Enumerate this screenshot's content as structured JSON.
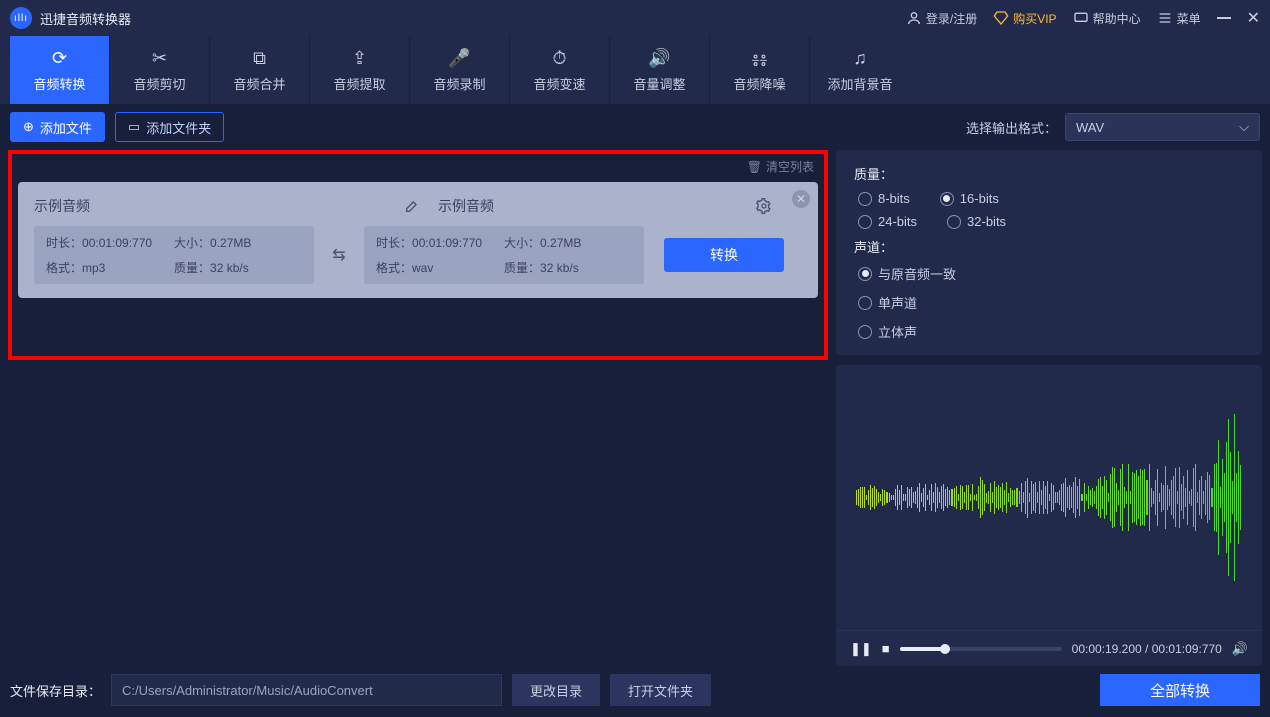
{
  "app": {
    "title": "迅捷音频转换器"
  },
  "header": {
    "login": "登录/注册",
    "vip": "购买VIP",
    "help": "帮助中心",
    "menu": "菜单"
  },
  "tabs": [
    "音频转换",
    "音频剪切",
    "音频合并",
    "音频提取",
    "音频录制",
    "音频变速",
    "音量调整",
    "音频降噪",
    "添加背景音"
  ],
  "actions": {
    "add_file": "添加文件",
    "add_folder": "添加文件夹",
    "format_label": "选择输出格式：",
    "format_value": "WAV"
  },
  "list": {
    "clear": "清空列表",
    "item": {
      "src_title": "示例音频",
      "dst_title": "示例音频",
      "src": {
        "duration_label": "时长：",
        "duration": "00:01:09:770",
        "size_label": "大小：",
        "size": "0.27MB",
        "format_label": "格式：",
        "format": "mp3",
        "quality_label": "质量：",
        "quality": "32 kb/s"
      },
      "dst": {
        "duration_label": "时长：",
        "duration": "00:01:09:770",
        "size_label": "大小：",
        "size": "0.27MB",
        "format_label": "格式：",
        "format": "wav",
        "quality_label": "质量：",
        "quality": "32 kb/s"
      },
      "convert_btn": "转换"
    }
  },
  "settings": {
    "quality_label": "质量：",
    "quality_options": [
      "8-bits",
      "16-bits",
      "24-bits",
      "32-bits"
    ],
    "channel_label": "声道：",
    "channel_options": [
      "与原音频一致",
      "单声道",
      "立体声"
    ]
  },
  "playback": {
    "current": "00:00:19.200",
    "total": "00:01:09:770"
  },
  "footer": {
    "label": "文件保存目录：",
    "path": "C:/Users/Administrator/Music/AudioConvert",
    "change_dir": "更改目录",
    "open_folder": "打开文件夹",
    "convert_all": "全部转换"
  }
}
